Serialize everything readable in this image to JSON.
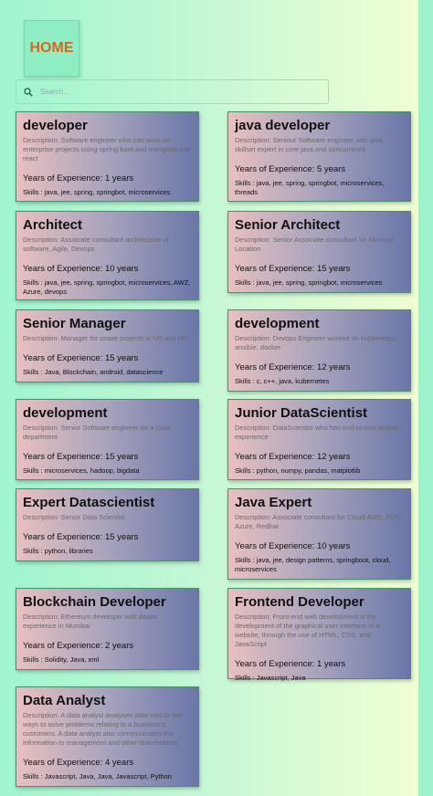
{
  "header": {
    "home_label": "HOME"
  },
  "search": {
    "placeholder": "Search..."
  },
  "cards": [
    {
      "title": "developer",
      "description": "Description: Software engineer who can work on enterprise projects using spring boot and mongodb and react",
      "experience": "Years of Experience: 1 years",
      "skills": "Skills : java, jee, spring, springbot, microservices"
    },
    {
      "title": "java developer",
      "description": "Description: Seniour Software engineer with java skillset expert in core java and concurrency",
      "experience": "Years of Experience: 5 years",
      "skills": "Skills : java, jee, spring, springbot, microservices, threads"
    },
    {
      "title": "Architect",
      "description": "Description: Assoicate consultant architecture of software, Agile, Devops",
      "experience": "Years of Experience: 10 years",
      "skills": "Skills : java, jee, spring, springbot, microservices, AWZ, Azure, devops"
    },
    {
      "title": "Senior Architect",
      "description": "Description: Senior Associate consultant for Mumbai Location",
      "experience": "Years of Experience: 15 years",
      "skills": "Skills : java, jee, spring, springbot, microservices"
    },
    {
      "title": "Senior Manager",
      "description": "Description: Manager for onsite projects in US and UK",
      "experience": "Years of Experience: 15 years",
      "skills": "Skills : Java, Blockchain, android, datascience"
    },
    {
      "title": "development",
      "description": "Description: Devops Engineer worked on kubernetes, ansible, docker",
      "experience": "Years of Experience: 12 years",
      "skills": "Skills : c, c++, java, kubernetes"
    },
    {
      "title": "development",
      "description": "Description: Senior Software engineer for a Data department",
      "experience": "Years of Experience: 15 years",
      "skills": "Skills : microservices, hadoop, bigdata"
    },
    {
      "title": "Junior DataScientist",
      "description": "Description: DataScientist who has end-to-end project experience",
      "experience": "Years of Experience: 12 years",
      "skills": "Skills : python, numpy, pandas, matplotlib"
    },
    {
      "title": "Expert Datascientist",
      "description": "Description: Senior Data Scientist",
      "experience": "Years of Experience: 15 years",
      "skills": "Skills : python, libraries"
    },
    {
      "title": "Java Expert",
      "description": "Description: Associate consultant for Cloud AWS, PCF, Azure, Redhat",
      "experience": "Years of Experience: 10 years",
      "skills": "Skills : java, jee, design patterns, springboot, cloud, microservices"
    },
    {
      "title": "Blockchain Developer",
      "description": "Description: Ethereum developer with dapps experience in Mumbai",
      "experience": "Years of Experience: 2 years",
      "skills": "Skills : Solidity, Java, xml"
    },
    {
      "title": "Frontend Developer",
      "description": "Description: Front-end web development is the development of the graphical user interface of a website, through the use of HTML, CSS, and JavaScript",
      "experience": "Years of Experience: 1 years",
      "skills": "Skills : Javascript, Java"
    },
    {
      "title": "Data Analyst",
      "description": "Description: A data analyst analyses data sets to find ways to solve problems relating to a business's customers. A data analyst also communicates this information to management and other stakeholders.",
      "experience": "Years of Experience: 4 years",
      "skills": "Skills : Javascript, Java, Java, Javascript, Python"
    }
  ]
}
